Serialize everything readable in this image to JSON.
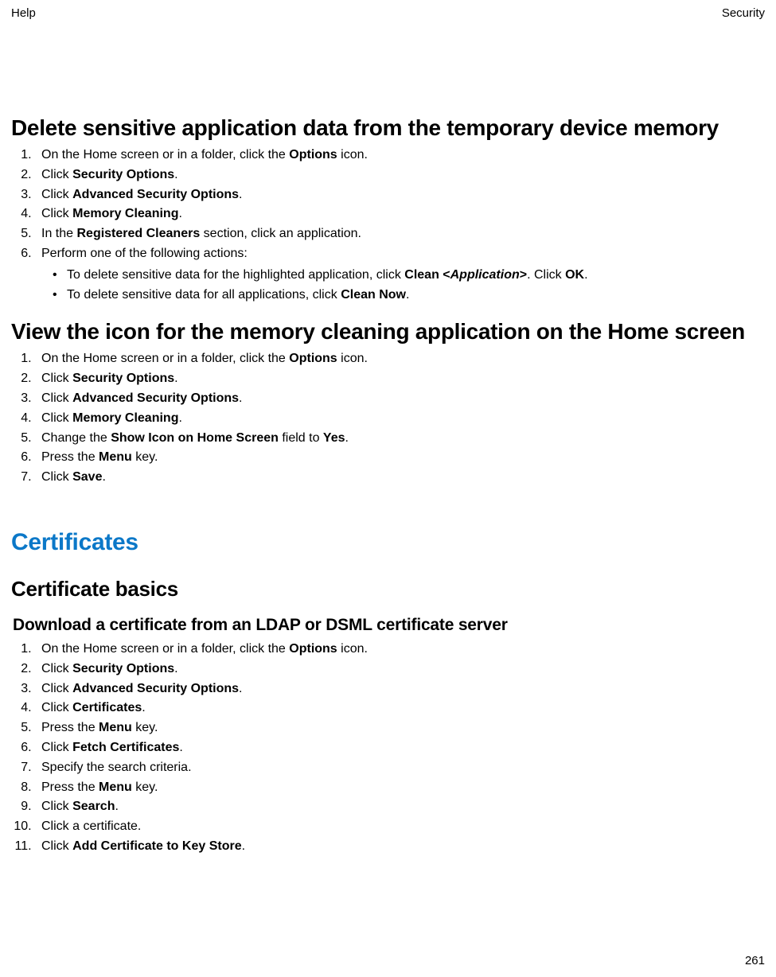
{
  "header": {
    "left": "Help",
    "right": "Security"
  },
  "footer": {
    "page": "261"
  },
  "topic1": {
    "title": "Delete sensitive application data from the temporary device memory",
    "steps": [
      {
        "pre": "On the Home screen or in a folder, click the ",
        "bold": "Options",
        "post": " icon."
      },
      {
        "pre": "Click ",
        "bold": "Security Options",
        "post": "."
      },
      {
        "pre": "Click ",
        "bold": "Advanced Security Options",
        "post": "."
      },
      {
        "pre": "Click ",
        "bold": "Memory Cleaning",
        "post": "."
      },
      {
        "pre": "In the ",
        "bold": "Registered Cleaners",
        "post": " section, click an application."
      },
      {
        "pre": "Perform one of the following actions:",
        "bold": "",
        "post": ""
      }
    ],
    "sub": [
      {
        "pre": "To delete sensitive data for the highlighted application, click ",
        "bold1": "Clean <",
        "bi": "Application",
        "bold2": ">",
        "mid": ". Click ",
        "bold3": "OK",
        "post": "."
      },
      {
        "pre": "To delete sensitive data for all applications, click ",
        "bold1": "Clean Now",
        "bi": "",
        "bold2": "",
        "mid": "",
        "bold3": "",
        "post": "."
      }
    ]
  },
  "topic2": {
    "title": "View the icon for the memory cleaning application on the Home screen",
    "steps": [
      {
        "pre": "On the Home screen or in a folder, click the ",
        "bold": "Options",
        "post": " icon."
      },
      {
        "pre": "Click ",
        "bold": "Security Options",
        "post": "."
      },
      {
        "pre": "Click ",
        "bold": "Advanced Security Options",
        "post": "."
      },
      {
        "pre": "Click ",
        "bold": "Memory Cleaning",
        "post": "."
      },
      {
        "pre": "Change the ",
        "bold": "Show Icon on Home Screen",
        "post": " field to ",
        "bold2": "Yes",
        "post2": "."
      },
      {
        "pre": "Press the ",
        "bold": "Menu",
        "post": " key."
      },
      {
        "pre": "Click ",
        "bold": "Save",
        "post": "."
      }
    ]
  },
  "section": {
    "title": "Certificates"
  },
  "subsection": {
    "title": "Certificate basics"
  },
  "task1": {
    "title": "Download a certificate from an LDAP or DSML certificate server",
    "steps": [
      {
        "pre": "On the Home screen or in a folder, click the ",
        "bold": "Options",
        "post": " icon."
      },
      {
        "pre": "Click ",
        "bold": "Security Options",
        "post": "."
      },
      {
        "pre": "Click ",
        "bold": "Advanced Security Options",
        "post": "."
      },
      {
        "pre": "Click ",
        "bold": "Certificates",
        "post": "."
      },
      {
        "pre": "Press the ",
        "bold": "Menu",
        "post": " key."
      },
      {
        "pre": "Click ",
        "bold": "Fetch Certificates",
        "post": "."
      },
      {
        "pre": "Specify the search criteria.",
        "bold": "",
        "post": ""
      },
      {
        "pre": "Press the ",
        "bold": "Menu",
        "post": " key."
      },
      {
        "pre": "Click ",
        "bold": "Search",
        "post": "."
      },
      {
        "pre": "Click a certificate.",
        "bold": "",
        "post": ""
      },
      {
        "pre": "Click ",
        "bold": "Add Certificate to Key Store",
        "post": "."
      }
    ]
  }
}
